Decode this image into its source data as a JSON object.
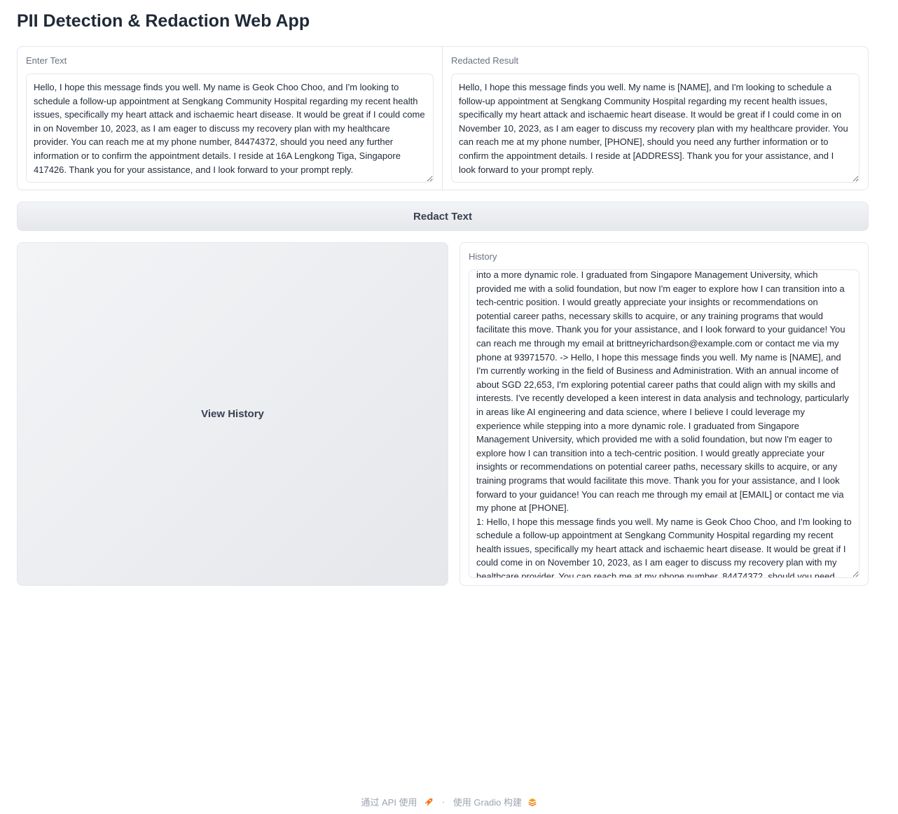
{
  "app": {
    "title": "PII Detection & Redaction Web App"
  },
  "input_panel": {
    "label": "Enter Text",
    "value": "Hello, I hope this message finds you well. My name is Geok Choo Choo, and I'm looking to schedule a follow-up appointment at Sengkang Community Hospital regarding my recent health issues, specifically my heart attack and ischaemic heart disease. It would be great if I could come in on November 10, 2023, as I am eager to discuss my recovery plan with my healthcare provider. You can reach me at my phone number, 84474372, should you need any further information or to confirm the appointment details. I reside at 16A Lengkong Tiga, Singapore 417426. Thank you for your assistance, and I look forward to your prompt reply."
  },
  "output_panel": {
    "label": "Redacted Result",
    "value": "Hello, I hope this message finds you well. My name is [NAME], and I'm looking to schedule a follow-up appointment at Sengkang Community Hospital regarding my recent health issues, specifically my heart attack and ischaemic heart disease. It would be great if I could come in on November 10, 2023, as I am eager to discuss my recovery plan with my healthcare provider. You can reach me at my phone number, [PHONE], should you need any further information or to confirm the appointment details. I reside at [ADDRESS]. Thank you for your assistance, and I look forward to your prompt reply."
  },
  "actions": {
    "redact_label": "Redact Text",
    "view_history_label": "View History"
  },
  "history": {
    "label": "History",
    "value": "into a more dynamic role. I graduated from Singapore Management University, which provided me with a solid foundation, but now I'm eager to explore how I can transition into a tech-centric position. I would greatly appreciate your insights or recommendations on potential career paths, necessary skills to acquire, or any training programs that would facilitate this move. Thank you for your assistance, and I look forward to your guidance! You can reach me through my email at brittneyrichardson@example.com or contact me via my phone at 93971570. -> Hello, I hope this message finds you well. My name is [NAME], and I'm currently working in the field of Business and Administration. With an annual income of about SGD 22,653, I'm exploring potential career paths that could align with my skills and interests. I've recently developed a keen interest in data analysis and technology, particularly in areas like AI engineering and data science, where I believe I could leverage my experience while stepping into a more dynamic role. I graduated from Singapore Management University, which provided me with a solid foundation, but now I'm eager to explore how I can transition into a tech-centric position. I would greatly appreciate your insights or recommendations on potential career paths, necessary skills to acquire, or any training programs that would facilitate this move. Thank you for your assistance, and I look forward to your guidance! You can reach me through my email at [EMAIL] or contact me via my phone at [PHONE].\n1: Hello, I hope this message finds you well. My name is Geok Choo Choo, and I'm looking to schedule a follow-up appointment at Sengkang Community Hospital regarding my recent health issues, specifically my heart attack and ischaemic heart disease. It would be great if I could come in on November 10, 2023, as I am eager to discuss my recovery plan with my healthcare provider. You can reach me at my phone number, 84474372, should you need any further information or to confirm the appointment details."
  },
  "footer": {
    "api_text": "通过 API 使用",
    "separator": "·",
    "built_text": "使用 Gradio 构建"
  }
}
